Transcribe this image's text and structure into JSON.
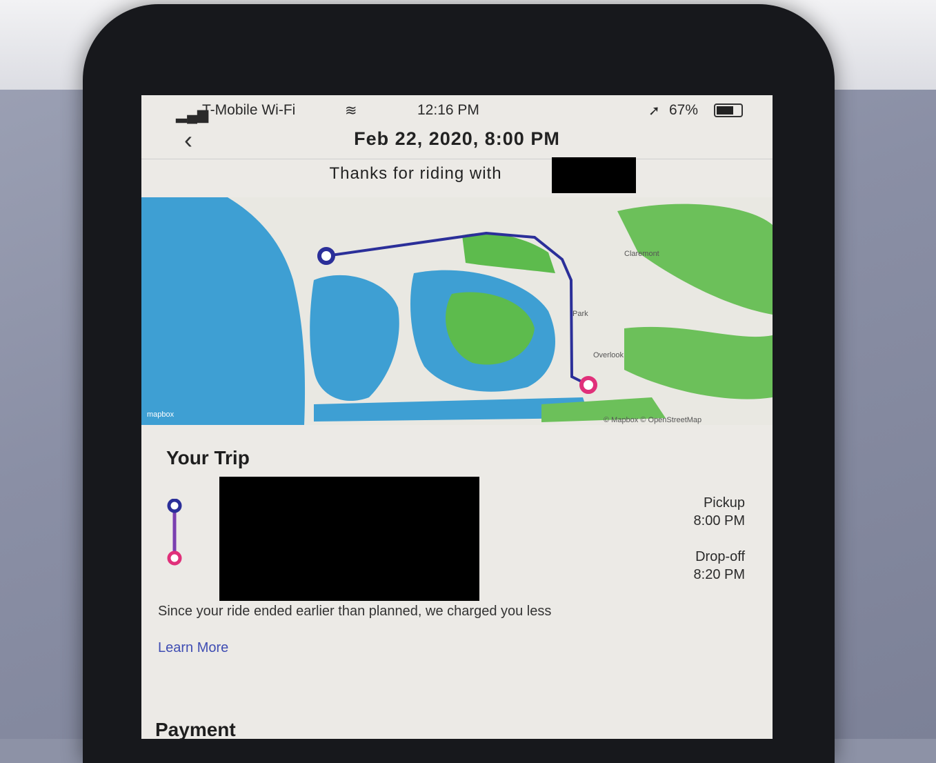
{
  "status_bar": {
    "carrier": "T-Mobile Wi-Fi",
    "time": "12:16 PM",
    "battery": "67%"
  },
  "header": {
    "title": "Feb 22, 2020, 8:00 PM"
  },
  "thanks_message": "Thanks for riding with",
  "map": {
    "labels": [
      "Claremont",
      "Overlook",
      "Park"
    ],
    "attribution": "© Mapbox © OpenStreetMap",
    "logo": "mapbox",
    "route_colors": {
      "route": "#2b2f99",
      "pickup": "#2b2f99",
      "dropoff": "#e0307a"
    }
  },
  "trip": {
    "section_title": "Your Trip",
    "pickup_label": "Pickup",
    "pickup_time": "8:00 PM",
    "dropoff_label": "Drop-off",
    "dropoff_time": "8:20 PM",
    "note": "Since your ride ended earlier than planned, we charged you less",
    "learn_more": "Learn More"
  },
  "payment": {
    "section_title": "Payment"
  }
}
